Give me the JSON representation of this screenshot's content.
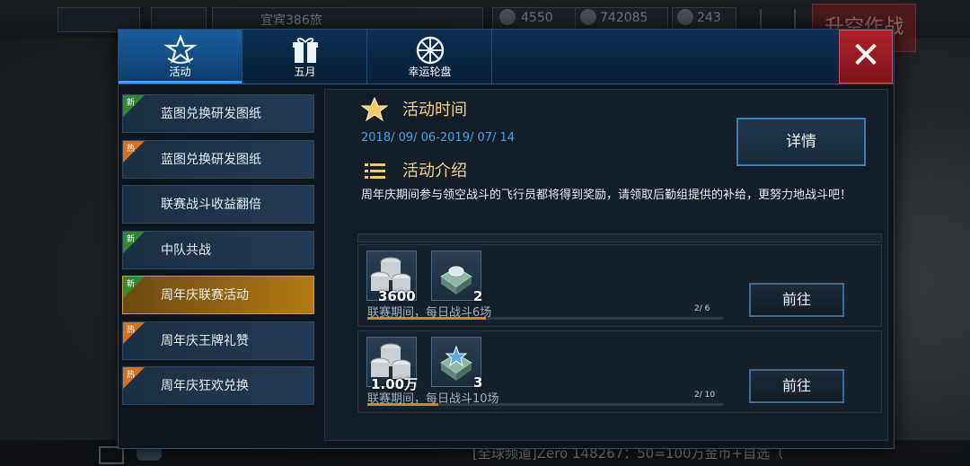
{
  "hud": {
    "clan_name": "宜宾386旅",
    "star_count": "4550",
    "silver": "742085",
    "gold": "243",
    "upgrade_label": "升空作战",
    "chat_text": "[全球频道]Zero 148267：50=100万金币+自选（"
  },
  "tabs": [
    {
      "label": "活动",
      "icon": "star-medal-icon",
      "active": true
    },
    {
      "label": "五月",
      "icon": "gift-box-icon",
      "active": false
    },
    {
      "label": "幸运轮盘",
      "icon": "roulette-wheel-icon",
      "active": false
    }
  ],
  "close_label": "✕",
  "menu": [
    {
      "label": "蓝图兑换研发图纸",
      "tag": "新",
      "tag_type": "new"
    },
    {
      "label": "蓝图兑换研发图纸",
      "tag": "热",
      "tag_type": "hot"
    },
    {
      "label": "联赛战斗收益翻倍",
      "tag": "",
      "tag_type": ""
    },
    {
      "label": "中队共战",
      "tag": "新",
      "tag_type": "new"
    },
    {
      "label": "周年庆联赛活动",
      "tag": "新",
      "tag_type": "new",
      "active": true
    },
    {
      "label": "周年庆王牌礼赞",
      "tag": "热",
      "tag_type": "hot"
    },
    {
      "label": "周年庆狂欢兑换",
      "tag": "热",
      "tag_type": "hot"
    }
  ],
  "event": {
    "time_title": "活动时间",
    "time_range": "2018/ 09/ 06-2019/ 07/ 14",
    "detail_label": "详情",
    "intro_title": "活动介绍",
    "intro_text": "周年庆期间参与领空战斗的飞行员都将得到奖励，请领取后勤组提供的补给，更努力地战斗吧！"
  },
  "tasks": [
    {
      "coin_count": "3600",
      "item_count": "2",
      "desc": "联赛期间，每日战斗6场",
      "progress_text": "2/ 6",
      "progress": 0.333,
      "go_label": "前往"
    },
    {
      "coin_count": "1.00万",
      "item_count": "3",
      "desc": "联赛期间，每日战斗10场",
      "progress_text": "2/ 10",
      "progress": 0.2,
      "go_label": "前往"
    }
  ],
  "colors": {
    "accent_blue": "#3fa7e8",
    "title_gold": "#f1d08a",
    "close_red": "#b2232a",
    "active_orange": "#b27a12",
    "tag_new": "#2f8a2f",
    "tag_hot": "#d8701a"
  }
}
